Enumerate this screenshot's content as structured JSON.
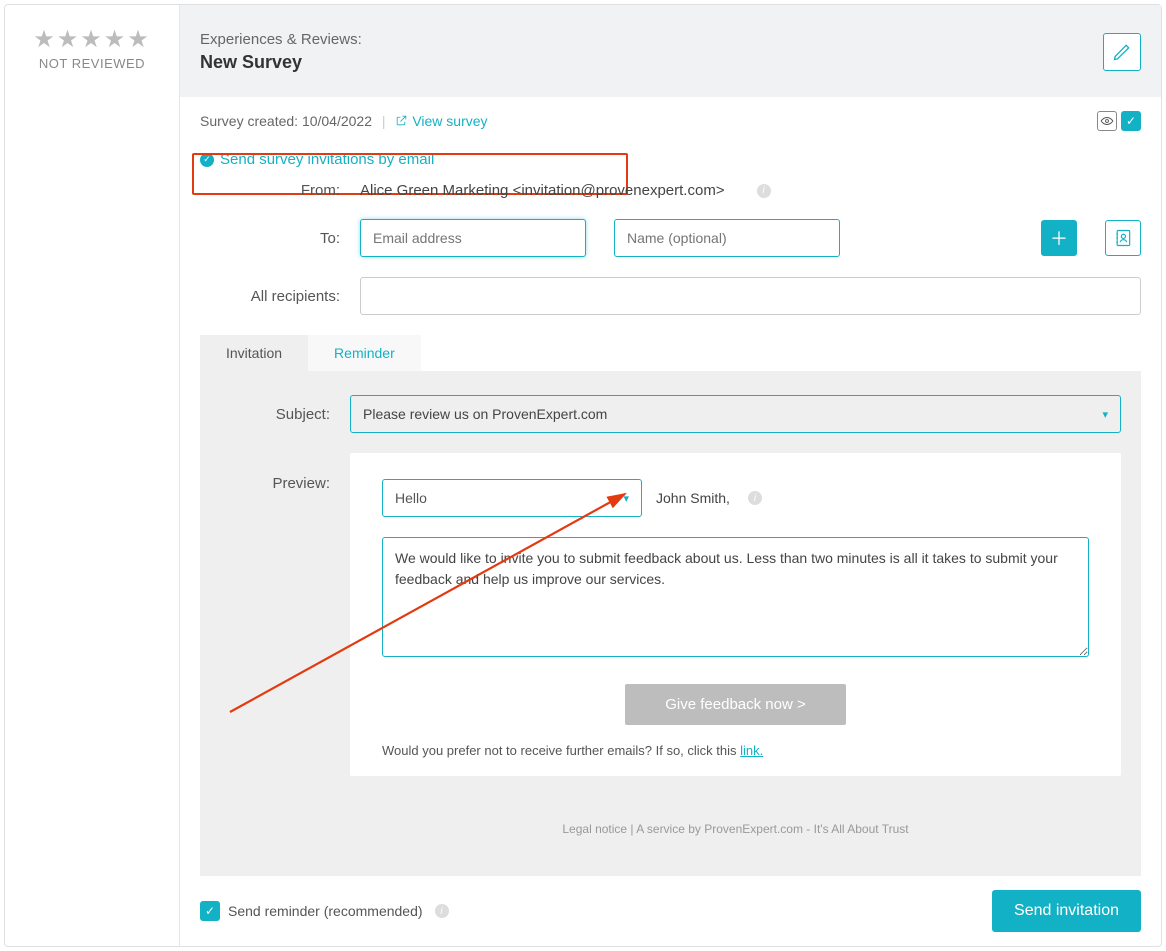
{
  "left": {
    "stars": "★★★★★",
    "not_reviewed": "NOT REVIEWED"
  },
  "header": {
    "sub": "Experiences & Reviews:",
    "title": "New Survey"
  },
  "info": {
    "created_label": "Survey created: 10/04/2022",
    "divider": "|",
    "view": "View survey"
  },
  "send_link": "Send survey invitations by email",
  "form": {
    "from_label": "From:",
    "from_value": "Alice Green Marketing <invitation@provenexpert.com>",
    "to_label": "To:",
    "email_placeholder": "Email address",
    "name_placeholder": "Name (optional)",
    "recipients_label": "All recipients:"
  },
  "tabs": {
    "invitation": "Invitation",
    "reminder": "Reminder"
  },
  "invitation": {
    "subject_label": "Subject:",
    "subject_value": "Please review us on ProvenExpert.com",
    "preview_label": "Preview:",
    "greeting_value": "Hello",
    "greeting_name": "John Smith,",
    "body": "We would like to invite you to submit feedback about us. Less than two minutes is all it takes to submit your feedback and help us improve our services.",
    "feedback_btn": "Give feedback now >",
    "unsub_text": "Would you prefer not to receive further emails? If so, click this ",
    "unsub_link": "link.",
    "legal": "Legal notice | A service by ProvenExpert.com - It's All About Trust"
  },
  "footer": {
    "reminder": "Send reminder (recommended)",
    "send": "Send invitation"
  }
}
